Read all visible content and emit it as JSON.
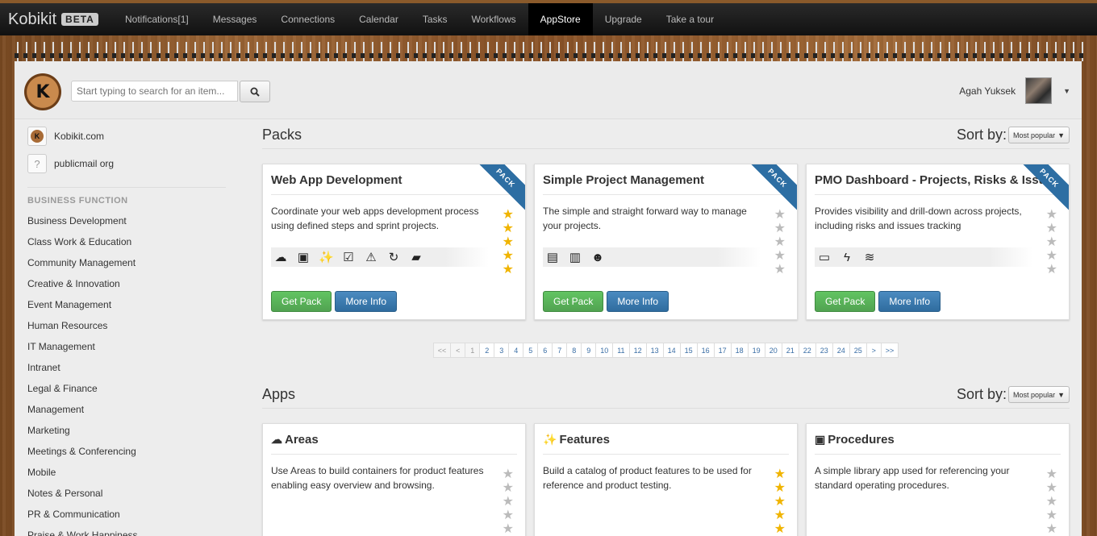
{
  "nav": {
    "brand": "Kobikit",
    "beta": "BETA",
    "items": [
      "Notifications[1]",
      "Messages",
      "Connections",
      "Calendar",
      "Tasks",
      "Workflows",
      "AppStore",
      "Upgrade",
      "Take a tour"
    ],
    "active": "AppStore"
  },
  "header": {
    "logo_text": "K",
    "search_placeholder": "Start typing to search for an item...",
    "user_name": "Agah Yuksek"
  },
  "sidebar": {
    "sites": [
      {
        "label": "Kobikit.com",
        "icon": "kobikit-logo-icon"
      },
      {
        "label": "publicmail org",
        "icon": "question-icon",
        "glyph": "?"
      }
    ],
    "section_title": "BUSINESS FUNCTION",
    "categories": [
      "Business Development",
      "Class Work & Education",
      "Community Management",
      "Creative & Innovation",
      "Event Management",
      "Human Resources",
      "IT Management",
      "Intranet",
      "Legal & Finance",
      "Management",
      "Marketing",
      "Meetings & Conferencing",
      "Mobile",
      "Notes & Personal",
      "PR & Communication",
      "Praise & Work Happiness"
    ]
  },
  "packs": {
    "title": "Packs",
    "sort_label": "Sort by:",
    "sort_value": "Most popular",
    "ribbon": "PACK",
    "get_label": "Get Pack",
    "info_label": "More Info",
    "cards": [
      {
        "title": "Web App Development",
        "desc": "Coordinate your web apps development process using defined steps and sprint projects.",
        "rating": 5,
        "icons": [
          "cloud-icon",
          "book-icon",
          "magic-wand-icon",
          "checkbox-icon",
          "warning-icon",
          "refresh-icon",
          "folder-gear-icon"
        ]
      },
      {
        "title": "Simple Project Management",
        "desc": "The simple and straight forward way to manage your projects.",
        "rating": 0,
        "icons": [
          "document-icon",
          "notebook-icon",
          "group-icon"
        ]
      },
      {
        "title": "PMO Dashboard - Projects, Risks & Issues",
        "desc": "Provides visibility and drill-down across projects, including risks and issues tracking",
        "rating": 0,
        "icons": [
          "monitor-icon",
          "lightning-icon",
          "heat-icon"
        ]
      }
    ]
  },
  "pagination": [
    "<<",
    "<",
    "1",
    "2",
    "3",
    "4",
    "5",
    "6",
    "7",
    "8",
    "9",
    "10",
    "11",
    "12",
    "13",
    "14",
    "15",
    "16",
    "17",
    "18",
    "19",
    "20",
    "21",
    "22",
    "23",
    "24",
    "25",
    ">",
    ">>"
  ],
  "apps": {
    "title": "Apps",
    "sort_label": "Sort by:",
    "sort_value": "Most popular",
    "cards": [
      {
        "title": "Areas",
        "icon": "cloud-icon",
        "glyph": "☁",
        "desc": "Use Areas to build containers for product features enabling easy overview and browsing.",
        "rating": 0
      },
      {
        "title": "Features",
        "icon": "magic-wand-icon",
        "glyph": "✨",
        "desc": "Build a catalog of product features to be used for reference and product testing.",
        "rating": 5
      },
      {
        "title": "Procedures",
        "icon": "book-icon",
        "glyph": "▣",
        "desc": "A simple library app used for referencing your standard operating procedures.",
        "rating": 0
      }
    ]
  }
}
